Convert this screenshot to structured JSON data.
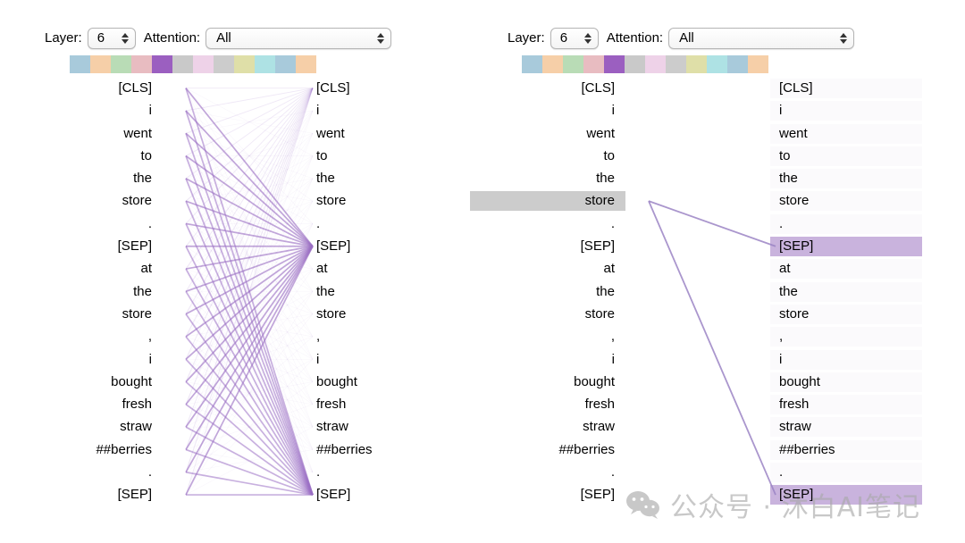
{
  "panels": [
    {
      "id": "left",
      "controls": {
        "layer_label": "Layer:",
        "layer_value": "6",
        "attention_label": "Attention:",
        "attention_value": "All"
      },
      "swatches": [
        {
          "name": "head-0",
          "color": "#a8cadb",
          "selected": false
        },
        {
          "name": "head-1",
          "color": "#f6cfa8",
          "selected": false
        },
        {
          "name": "head-2",
          "color": "#b9dcb6",
          "selected": false
        },
        {
          "name": "head-3",
          "color": "#e8bcc1",
          "selected": false
        },
        {
          "name": "head-4",
          "color": "#9b5fc0",
          "selected": true
        },
        {
          "name": "head-5",
          "color": "#c9c9c9",
          "selected": false
        },
        {
          "name": "head-6",
          "color": "#eed2e8",
          "selected": false
        },
        {
          "name": "head-7",
          "color": "#cccccc",
          "selected": false
        },
        {
          "name": "head-8",
          "color": "#dfdfa8",
          "selected": false
        },
        {
          "name": "head-9",
          "color": "#aee2e4",
          "selected": false
        },
        {
          "name": "head-10",
          "color": "#a8cadb",
          "selected": false
        },
        {
          "name": "head-11",
          "color": "#f6cfa8",
          "selected": false
        }
      ],
      "left_tokens": [
        {
          "text": "[CLS]",
          "highlight": "none"
        },
        {
          "text": "i",
          "highlight": "none"
        },
        {
          "text": "went",
          "highlight": "none"
        },
        {
          "text": "to",
          "highlight": "none"
        },
        {
          "text": "the",
          "highlight": "none"
        },
        {
          "text": "store",
          "highlight": "none"
        },
        {
          "text": ".",
          "highlight": "none"
        },
        {
          "text": "[SEP]",
          "highlight": "none"
        },
        {
          "text": "at",
          "highlight": "none"
        },
        {
          "text": "the",
          "highlight": "none"
        },
        {
          "text": "store",
          "highlight": "none"
        },
        {
          "text": ",",
          "highlight": "none"
        },
        {
          "text": "i",
          "highlight": "none"
        },
        {
          "text": "bought",
          "highlight": "none"
        },
        {
          "text": "fresh",
          "highlight": "none"
        },
        {
          "text": "straw",
          "highlight": "none"
        },
        {
          "text": "##berries",
          "highlight": "none"
        },
        {
          "text": ".",
          "highlight": "none"
        },
        {
          "text": "[SEP]",
          "highlight": "none"
        }
      ],
      "right_tokens": [
        {
          "text": "[CLS]",
          "highlight": "none"
        },
        {
          "text": "i",
          "highlight": "none"
        },
        {
          "text": "went",
          "highlight": "none"
        },
        {
          "text": "to",
          "highlight": "none"
        },
        {
          "text": "the",
          "highlight": "none"
        },
        {
          "text": "store",
          "highlight": "none"
        },
        {
          "text": ".",
          "highlight": "none"
        },
        {
          "text": "[SEP]",
          "highlight": "none"
        },
        {
          "text": "at",
          "highlight": "none"
        },
        {
          "text": "the",
          "highlight": "none"
        },
        {
          "text": "store",
          "highlight": "none"
        },
        {
          "text": ",",
          "highlight": "none"
        },
        {
          "text": "i",
          "highlight": "none"
        },
        {
          "text": "bought",
          "highlight": "none"
        },
        {
          "text": "fresh",
          "highlight": "none"
        },
        {
          "text": "straw",
          "highlight": "none"
        },
        {
          "text": "##berries",
          "highlight": "none"
        },
        {
          "text": ".",
          "highlight": "none"
        },
        {
          "text": "[SEP]",
          "highlight": "none"
        }
      ],
      "attention_mode": "all",
      "line_color": "#9b6fc4"
    },
    {
      "id": "right",
      "controls": {
        "layer_label": "Layer:",
        "layer_value": "6",
        "attention_label": "Attention:",
        "attention_value": "All"
      },
      "swatches": [
        {
          "name": "head-0",
          "color": "#a8cadb",
          "selected": false
        },
        {
          "name": "head-1",
          "color": "#f6cfa8",
          "selected": false
        },
        {
          "name": "head-2",
          "color": "#b9dcb6",
          "selected": false
        },
        {
          "name": "head-3",
          "color": "#e8bcc1",
          "selected": false
        },
        {
          "name": "head-4",
          "color": "#9b5fc0",
          "selected": true
        },
        {
          "name": "head-5",
          "color": "#c9c9c9",
          "selected": false
        },
        {
          "name": "head-6",
          "color": "#eed2e8",
          "selected": false
        },
        {
          "name": "head-7",
          "color": "#cccccc",
          "selected": false
        },
        {
          "name": "head-8",
          "color": "#dfdfa8",
          "selected": false
        },
        {
          "name": "head-9",
          "color": "#aee2e4",
          "selected": false
        },
        {
          "name": "head-10",
          "color": "#a8cadb",
          "selected": false
        },
        {
          "name": "head-11",
          "color": "#f6cfa8",
          "selected": false
        }
      ],
      "left_tokens": [
        {
          "text": "[CLS]",
          "highlight": "none"
        },
        {
          "text": "i",
          "highlight": "none"
        },
        {
          "text": "went",
          "highlight": "none"
        },
        {
          "text": "to",
          "highlight": "none"
        },
        {
          "text": "the",
          "highlight": "none"
        },
        {
          "text": "store",
          "highlight": "selected"
        },
        {
          "text": ".",
          "highlight": "none"
        },
        {
          "text": "[SEP]",
          "highlight": "none"
        },
        {
          "text": "at",
          "highlight": "none"
        },
        {
          "text": "the",
          "highlight": "none"
        },
        {
          "text": "store",
          "highlight": "none"
        },
        {
          "text": ",",
          "highlight": "none"
        },
        {
          "text": "i",
          "highlight": "none"
        },
        {
          "text": "bought",
          "highlight": "none"
        },
        {
          "text": "fresh",
          "highlight": "none"
        },
        {
          "text": "straw",
          "highlight": "none"
        },
        {
          "text": "##berries",
          "highlight": "none"
        },
        {
          "text": ".",
          "highlight": "none"
        },
        {
          "text": "[SEP]",
          "highlight": "none"
        }
      ],
      "right_tokens": [
        {
          "text": "[CLS]",
          "highlight": "faint"
        },
        {
          "text": "i",
          "highlight": "faint"
        },
        {
          "text": "went",
          "highlight": "faint"
        },
        {
          "text": "to",
          "highlight": "faint"
        },
        {
          "text": "the",
          "highlight": "faint"
        },
        {
          "text": "store",
          "highlight": "faint"
        },
        {
          "text": ".",
          "highlight": "faint"
        },
        {
          "text": "[SEP]",
          "highlight": "attn"
        },
        {
          "text": "at",
          "highlight": "faint"
        },
        {
          "text": "the",
          "highlight": "faint"
        },
        {
          "text": "store",
          "highlight": "faint"
        },
        {
          "text": ",",
          "highlight": "faint"
        },
        {
          "text": "i",
          "highlight": "faint"
        },
        {
          "text": "bought",
          "highlight": "faint"
        },
        {
          "text": "fresh",
          "highlight": "faint"
        },
        {
          "text": "straw",
          "highlight": "faint"
        },
        {
          "text": "##berries",
          "highlight": "faint"
        },
        {
          "text": ".",
          "highlight": "faint"
        },
        {
          "text": "[SEP]",
          "highlight": "attn"
        }
      ],
      "attention_mode": "single",
      "selected_source_index": 5,
      "line_color": "#9b84c4"
    }
  ],
  "highlight_colors": {
    "selected": "#cccccc",
    "attn": "#c9b3dd",
    "faint": "#fbfafc"
  },
  "watermark": {
    "icon": "wechat-icon",
    "text": "公众号 · 沐白AI笔记"
  }
}
